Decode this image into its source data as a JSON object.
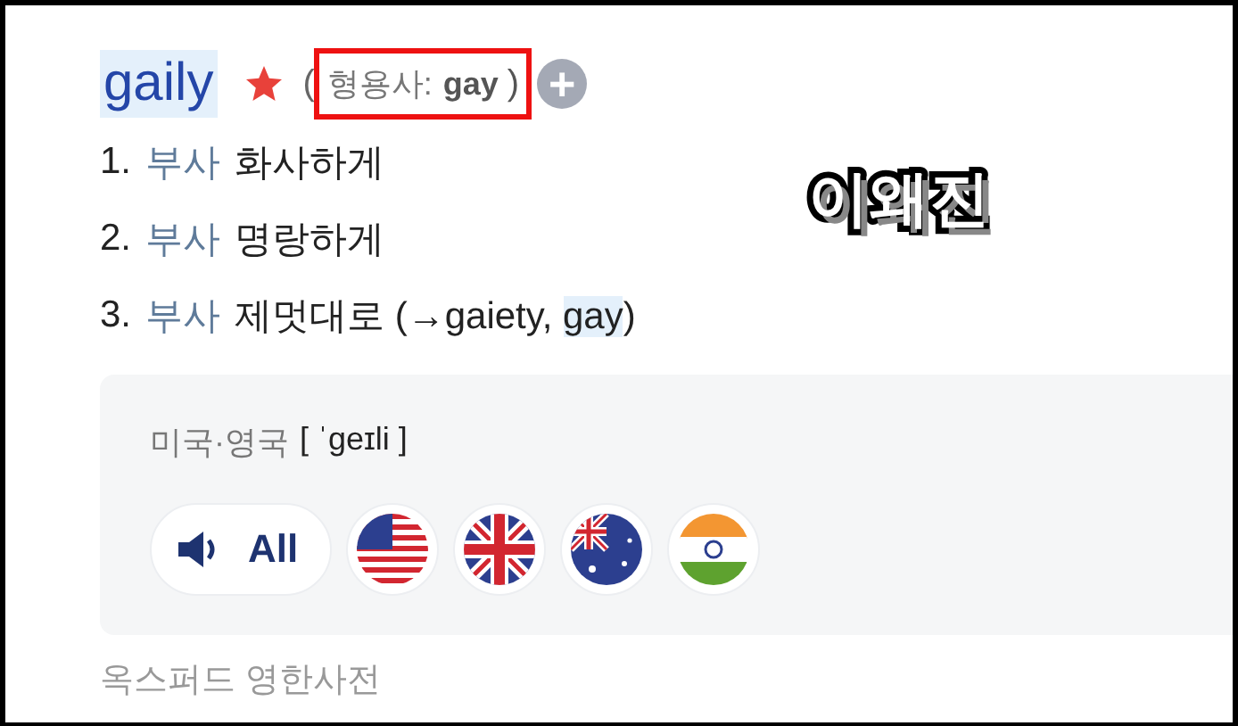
{
  "entry": {
    "headword": "gaily",
    "starred": true,
    "paren_open": "(",
    "pos_label": "형용사:",
    "base_word": "gay",
    "paren_close": ")",
    "add_button": "+"
  },
  "senses": [
    {
      "number": "1.",
      "pos": "부사",
      "meaning": "화사하게"
    },
    {
      "number": "2.",
      "pos": "부사",
      "meaning": "명랑하게"
    },
    {
      "number": "3.",
      "pos": "부사",
      "meaning": "제멋대로 (→gaiety, ",
      "highlight": "gay",
      "tail": ")"
    }
  ],
  "pronunciation": {
    "region": "미국·영국",
    "ipa": "[ ˈɡeɪli ]",
    "all_button": "All",
    "flags": [
      {
        "kind": "us"
      },
      {
        "kind": "uk"
      },
      {
        "kind": "au"
      },
      {
        "kind": "in"
      }
    ]
  },
  "source": "옥스퍼드 영한사전",
  "caption": "이왜진"
}
